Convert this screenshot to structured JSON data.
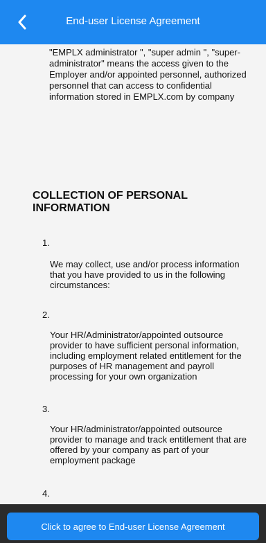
{
  "header": {
    "title": "End-user License Agreement",
    "back_icon": "chevron-left-icon"
  },
  "content": {
    "definition": "\"EMPLX administrator \", \"super admin \", \"super-administrator\" means the access given to the Employer and/or appointed personnel, authorized personnel that can access to confidential information stored in EMPLX.com by company",
    "section_title": "COLLECTION OF PERSONAL INFORMATION",
    "items": [
      {
        "number": "1.",
        "text": "We may collect, use and/or process information that you have provided to us in the following circumstances:"
      },
      {
        "number": "2.",
        "text": "Your HR/Administrator/appointed outsource provider to have sufficient personal information, including employment related entitlement for the purposes of HR management and payroll processing for your own organization"
      },
      {
        "number": "3.",
        "text": "Your HR/administrator/appointed outsource provider to manage and track entitlement that are offered by your company as part of your employment package"
      },
      {
        "number": "4.",
        "text": ""
      }
    ]
  },
  "footer": {
    "agree_label": "Click to agree to End-user License Agreement"
  },
  "colors": {
    "accent": "#1e88f0",
    "background": "#f4f4f4",
    "footer_bg": "#2b2b2b"
  }
}
